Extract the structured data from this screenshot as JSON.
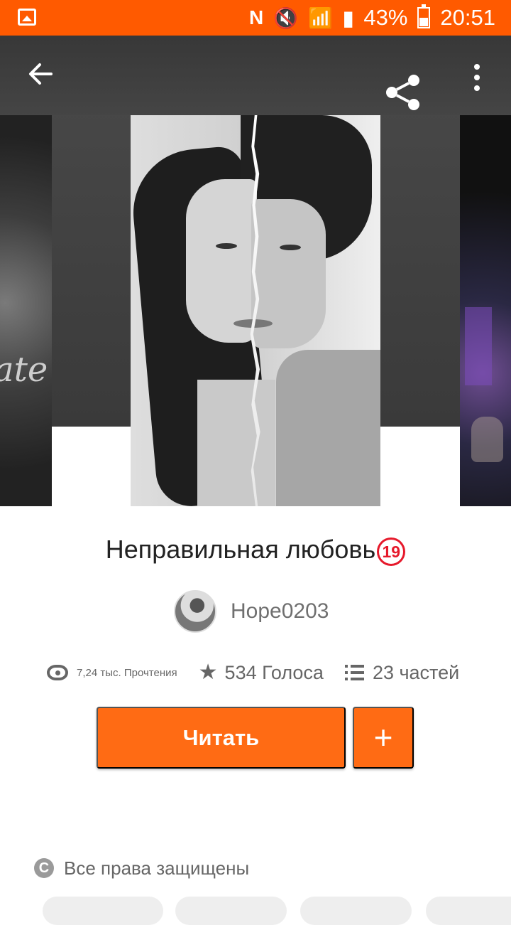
{
  "status_bar": {
    "battery": "43%",
    "time": "20:51",
    "icons": [
      "image-icon",
      "nfc-icon",
      "mute-icon",
      "wifi-icon",
      "signal-icon",
      "battery-icon"
    ]
  },
  "toolbar": {
    "back_icon": "arrow-left-icon",
    "share_icon": "share-icon",
    "more_icon": "more-vertical-icon"
  },
  "book": {
    "title": "Неправильная любовь",
    "age_rating": "19",
    "author": "Hope0203"
  },
  "stats": {
    "reads": "7,24 тыс. Прочтения",
    "votes": "534 Голоса",
    "parts": "23 частей"
  },
  "actions": {
    "read_label": "Читать",
    "add_label": "+"
  },
  "footer": {
    "rights": "Все права защищены"
  },
  "colors": {
    "accent": "#ff6b14",
    "status_bar": "#ff5a00",
    "age_badge": "#e6192b"
  }
}
